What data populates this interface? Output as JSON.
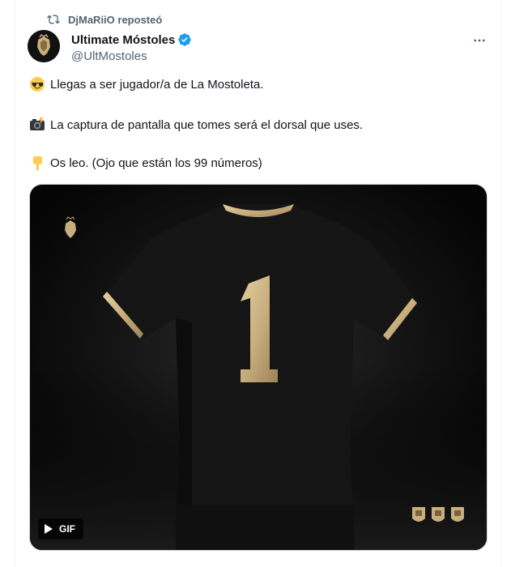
{
  "repost": {
    "text": "DjMaRiiO reposteó"
  },
  "author": {
    "name": "Ultimate Móstoles",
    "handle": "@UltMostoles"
  },
  "tweet": {
    "lines": [
      {
        "emoji": "smiling-face-with-sunglasses",
        "text": "Llegas a ser jugador/a de La Mostoleta."
      },
      {
        "emoji": "camera-with-flash",
        "text": "La captura de pantalla que tomes será el dorsal que uses."
      },
      {
        "emoji": "backhand-index-pointing-down",
        "text": "Os leo. (Ojo que están los 99 números)"
      }
    ]
  },
  "media": {
    "jersey_number": "1",
    "gif_label": "GIF",
    "colors": {
      "shirt": "#141414",
      "gold": "#c8ae7d",
      "background": "#0a0a0a"
    }
  },
  "footer": {
    "partial_text": ""
  },
  "colors": {
    "text": "#0f1419",
    "secondary": "#536471",
    "verified": "#1d9bf0",
    "border": "#cfd9de"
  }
}
